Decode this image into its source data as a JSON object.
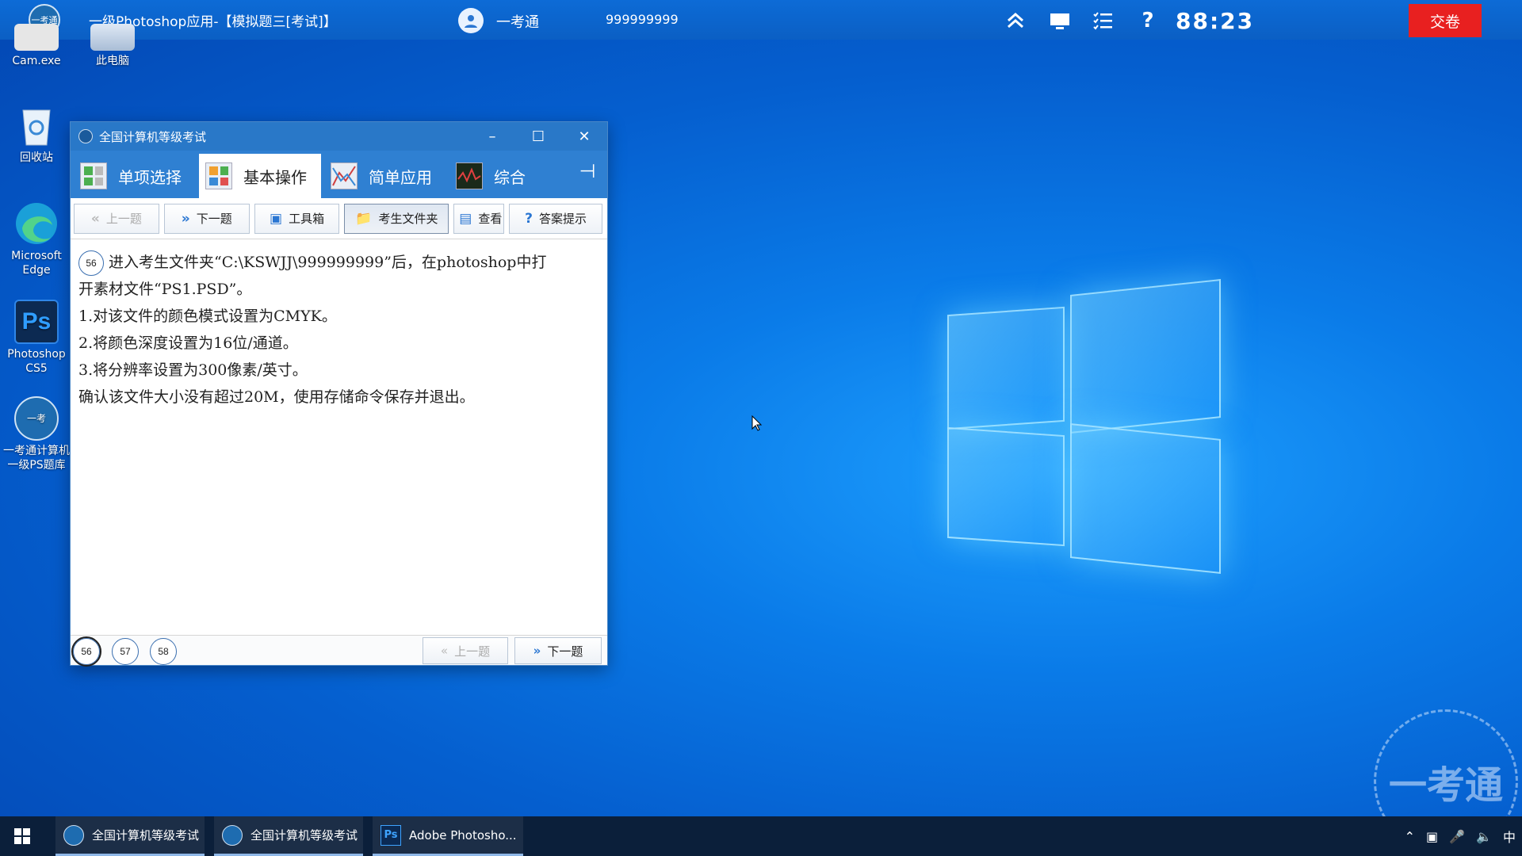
{
  "topbar": {
    "title": "一级Photoshop应用-【模拟题三[考试]】",
    "user_name": "一考通",
    "user_id": "999999999",
    "timer": "88:23",
    "submit_label": "交卷",
    "logo_text": "一考通"
  },
  "desktop": {
    "icons": [
      {
        "label": "Cam.exe"
      },
      {
        "label": "此电脑"
      },
      {
        "label": "回收站"
      },
      {
        "label": "Microsoft Edge"
      },
      {
        "label": "Photoshop CS5"
      },
      {
        "label": "一考通计算机一级PS题库"
      }
    ]
  },
  "exam_window": {
    "title": "全国计算机等级考试",
    "tabs": [
      {
        "label": "单项选择"
      },
      {
        "label": "基本操作"
      },
      {
        "label": "简单应用"
      },
      {
        "label": "综合"
      }
    ],
    "toolbar": {
      "prev": "上一题",
      "next": "下一题",
      "toolbox": "工具箱",
      "folder": "考生文件夹",
      "view": "查看",
      "hint": "答案提示"
    },
    "question": {
      "number": "56",
      "line1": "进入考生文件夹“C:\\KSWJJ\\999999999”后，在photoshop中打",
      "line2": "开素材文件“PS1.PSD”。",
      "line3": "1.对该文件的颜色模式设置为CMYK。",
      "line4": "2.将颜色深度设置为16位/通道。",
      "line5": "3.将分辨率设置为300像素/英寸。",
      "line6": "确认该文件大小没有超过20M，使用存储命令保存并退出。"
    },
    "bottom": {
      "q1": "56",
      "q2": "57",
      "q3": "58",
      "prev": "上一题",
      "next": "下一题"
    }
  },
  "taskbar": {
    "apps": [
      {
        "label": "全国计算机等级考试"
      },
      {
        "label": "全国计算机等级考试"
      },
      {
        "label": "Adobe Photosho..."
      }
    ],
    "ime": "中"
  },
  "watermark_text": "一考通",
  "colors": {
    "accent": "#2978c8",
    "submit": "#e82020",
    "taskbar": "#0b1f3a"
  }
}
